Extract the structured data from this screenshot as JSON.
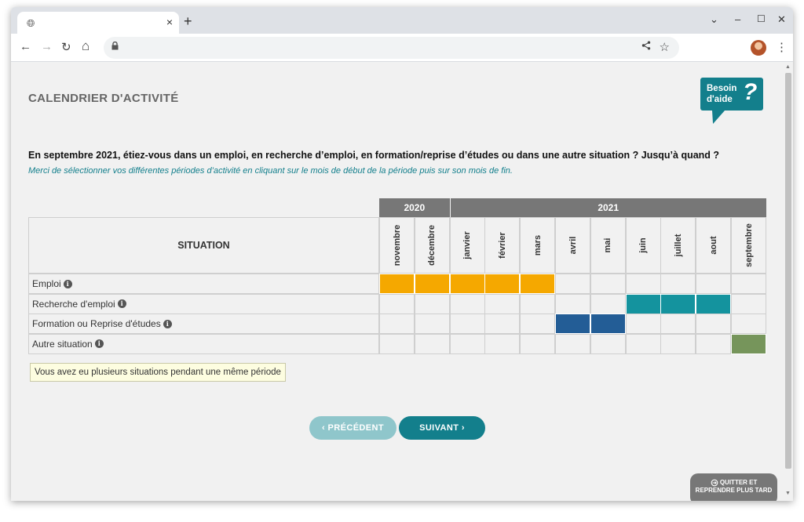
{
  "browser": {
    "tab_close": "×",
    "new_tab": "+",
    "win_chevron": "⌄",
    "win_minimize": "–",
    "win_maximize": "☐",
    "win_close": "✕",
    "back": "←",
    "forward": "→",
    "reload": "↻",
    "home": "⌂",
    "lock": "🔒",
    "share": "⋖",
    "star": "☆",
    "menu": "⋮"
  },
  "page": {
    "title": "CALENDRIER D'ACTIVITÉ",
    "help_line1": "Besoin",
    "help_line2": "d'aide",
    "help_mark": "?",
    "question": "En septembre 2021, étiez-vous dans un emploi, en recherche d’emploi, en formation/reprise d’études ou dans une autre situation ? Jusqu’à quand ?",
    "instruction": "Merci de sélectionner vos différentes périodes d’activité en cliquant sur le mois de début de la période puis sur son mois de fin."
  },
  "calendar": {
    "situation_header": "SITUATION",
    "years": [
      {
        "label": "2020",
        "span": 2
      },
      {
        "label": "2021",
        "span": 9
      }
    ],
    "months": [
      "novembre",
      "décembre",
      "janvier",
      "février",
      "mars",
      "avril",
      "mai",
      "juin",
      "juillet",
      "aout",
      "septembre"
    ],
    "rows": [
      {
        "label": "Emploi",
        "color": "#f5a800",
        "filled": [
          0,
          1,
          2,
          3,
          4
        ]
      },
      {
        "label": "Recherche d'emploi",
        "color": "#14939e",
        "filled": [
          7,
          8,
          9
        ]
      },
      {
        "label": "Formation ou Reprise d'études",
        "color": "#235d96",
        "filled": [
          5,
          6
        ]
      },
      {
        "label": "Autre situation",
        "color": "#76955b",
        "filled": [
          10
        ]
      }
    ],
    "info_glyph": "i"
  },
  "tooltip": "Vous avez eu plusieurs situations pendant une même période",
  "buttons": {
    "prev": "‹  PRÉCÉDENT",
    "next": "SUIVANT  ›"
  },
  "quit": {
    "line1": "QUITTER ET",
    "line2": "REPRENDRE PLUS TARD"
  },
  "colors": {
    "accent": "#137f8c",
    "header_gray": "#777777"
  }
}
